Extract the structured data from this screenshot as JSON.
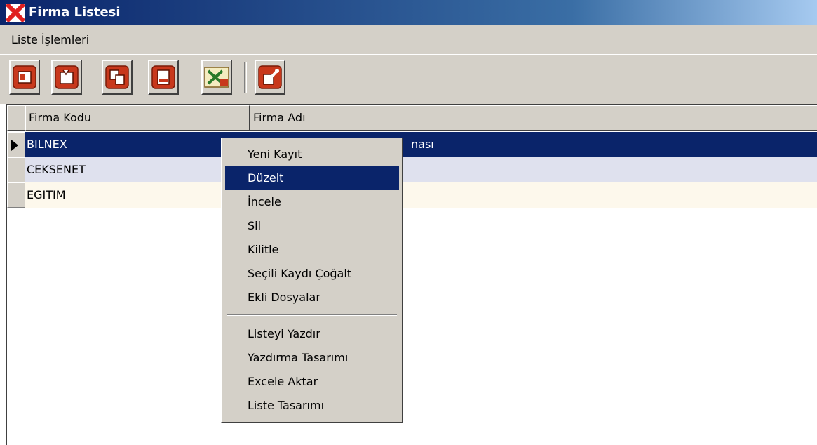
{
  "window": {
    "title": "Firma Listesi",
    "icon": "app-x-icon"
  },
  "menu": {
    "items": [
      {
        "label": "Liste İşlemleri"
      }
    ]
  },
  "toolbar": {
    "buttons": [
      {
        "icon": "new-record-icon"
      },
      {
        "icon": "edit-record-icon"
      },
      {
        "icon": "copy-record-icon"
      },
      {
        "icon": "print-icon"
      },
      {
        "icon": "excel-export-icon"
      },
      {
        "icon": "settings-icon"
      }
    ]
  },
  "grid": {
    "columns": [
      "Firma Kodu",
      "Firma Adı"
    ],
    "rows": [
      {
        "code": "BILNEX",
        "name": "nası"
      },
      {
        "code": "CEKSENET",
        "name": ""
      },
      {
        "code": "EGITIM",
        "name": ""
      }
    ]
  },
  "context_menu": {
    "items": [
      "Yeni Kayıt",
      "Düzelt",
      "İncele",
      "Sil",
      "Kilitle",
      "Seçili Kaydı Çoğalt",
      "Ekli Dosyalar",
      "Listeyi Yazdır",
      "Yazdırma Tasarımı",
      "Excele Aktar",
      "Liste Tasarımı"
    ],
    "highlighted": "Düzelt"
  },
  "colors": {
    "title_bar": "#0a246a",
    "selection": "#0a246a",
    "toolbar_button": "#c8381c",
    "panel": "#d4d0c8"
  }
}
